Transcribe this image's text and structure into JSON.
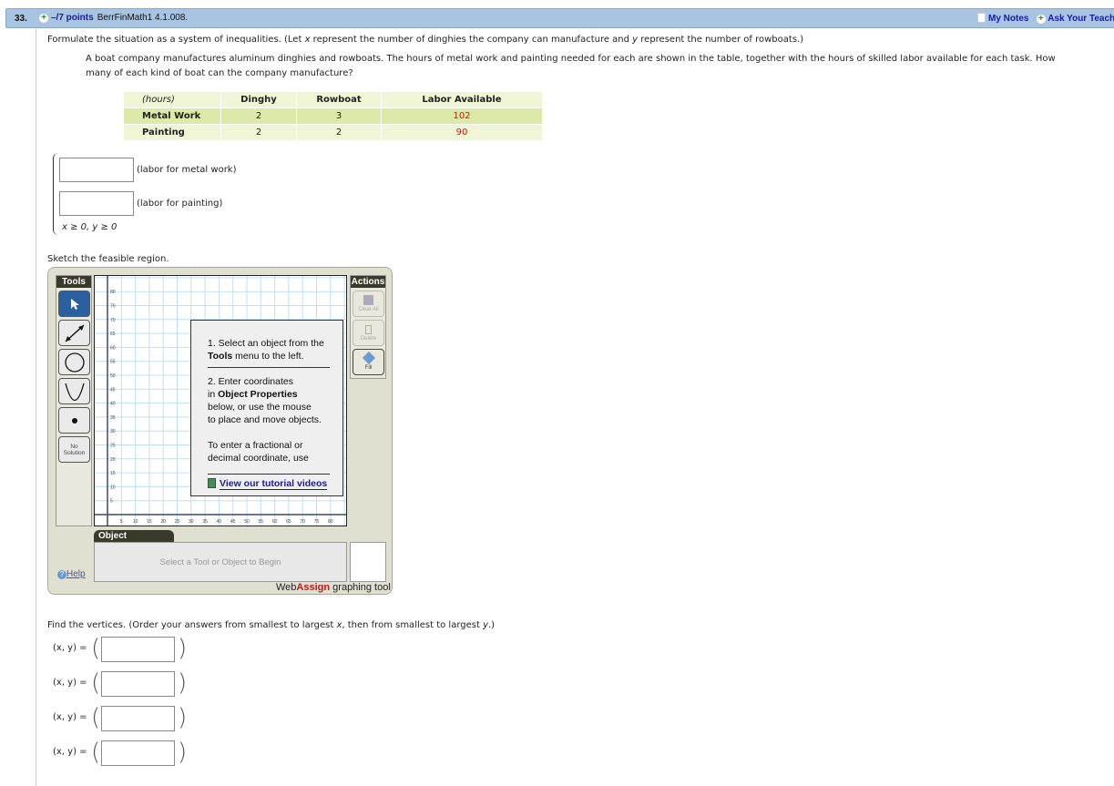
{
  "header": {
    "question_number": "33.",
    "points": "–/7 points",
    "question_id": "BerrFinMath1 4.1.008.",
    "my_notes": "My Notes",
    "ask_teacher": "Ask Your Teacher"
  },
  "question": {
    "intro_pre": "Formulate the situation as a system of inequalities. (Let ",
    "intro_x": "x",
    "intro_mid": " represent the number of dinghies the company can manufacture and ",
    "intro_y": "y",
    "intro_post": " represent the number of rowboats.)",
    "problem_line1": "A boat company manufactures aluminum dinghies and rowboats. The hours of metal work and painting needed for each are shown in the table, together with the hours of skilled labor available for each task. How",
    "problem_line2": "many of each kind of boat can the company manufacture?"
  },
  "table": {
    "headers": [
      "(hours)",
      "Dinghy",
      "Rowboat",
      "Labor Available"
    ],
    "rows": [
      [
        "Metal Work",
        "2",
        "3",
        "102"
      ],
      [
        "Painting",
        "2",
        "2",
        "90"
      ]
    ]
  },
  "system": {
    "inputs": [
      {
        "value": "",
        "label": "(labor for metal work)"
      },
      {
        "value": "",
        "label": "(labor for painting)"
      }
    ],
    "nonneg": "x ≥ 0, y ≥ 0"
  },
  "sketch_prompt": "Sketch the feasible region.",
  "graph_tool": {
    "tools_title": "Tools",
    "tools": [
      "pointer",
      "line",
      "circle",
      "parabola",
      "point",
      "No Solution"
    ],
    "no_solution_line1": "No",
    "no_solution_line2": "Solution",
    "actions_title": "Actions",
    "actions": [
      "Clear All",
      "Delete",
      "Fill"
    ],
    "y_ticks": [
      "80",
      "75",
      "70",
      "65",
      "60",
      "55",
      "50",
      "45",
      "40",
      "35",
      "30",
      "25",
      "20",
      "15",
      "10",
      "5"
    ],
    "x_ticks": [
      "5",
      "10",
      "15",
      "20",
      "25",
      "30",
      "35",
      "40",
      "45",
      "50",
      "55",
      "60",
      "65",
      "70",
      "75",
      "80"
    ],
    "tip_1a": "1. Select an object from the",
    "tip_1b_bold": "Tools",
    "tip_1b_rest": " menu to the left.",
    "tip_2a": "2. Enter coordinates",
    "tip_2b_pre": "in ",
    "tip_2b_bold": "Object Properties",
    "tip_2c": "below, or use the mouse",
    "tip_2d": "to place and move objects.",
    "tip_3a": "To enter a fractional or",
    "tip_3b": "decimal coordinate, use",
    "tutorial_link": "View our tutorial videos",
    "object_properties_title": "Object Properties",
    "object_properties_placeholder": "Select a Tool or Object to Begin",
    "help": "Help",
    "brand_web": "Web",
    "brand_assign": "Assign",
    "brand_suffix": " graphing tool"
  },
  "vertices": {
    "prompt_pre": "Find the vertices. (Order your answers from smallest to largest ",
    "prompt_x": "x",
    "prompt_mid": ", then from smallest to largest ",
    "prompt_y": "y",
    "prompt_post": ".)",
    "label": "(x, y) =",
    "answers": [
      "",
      "",
      "",
      ""
    ]
  }
}
